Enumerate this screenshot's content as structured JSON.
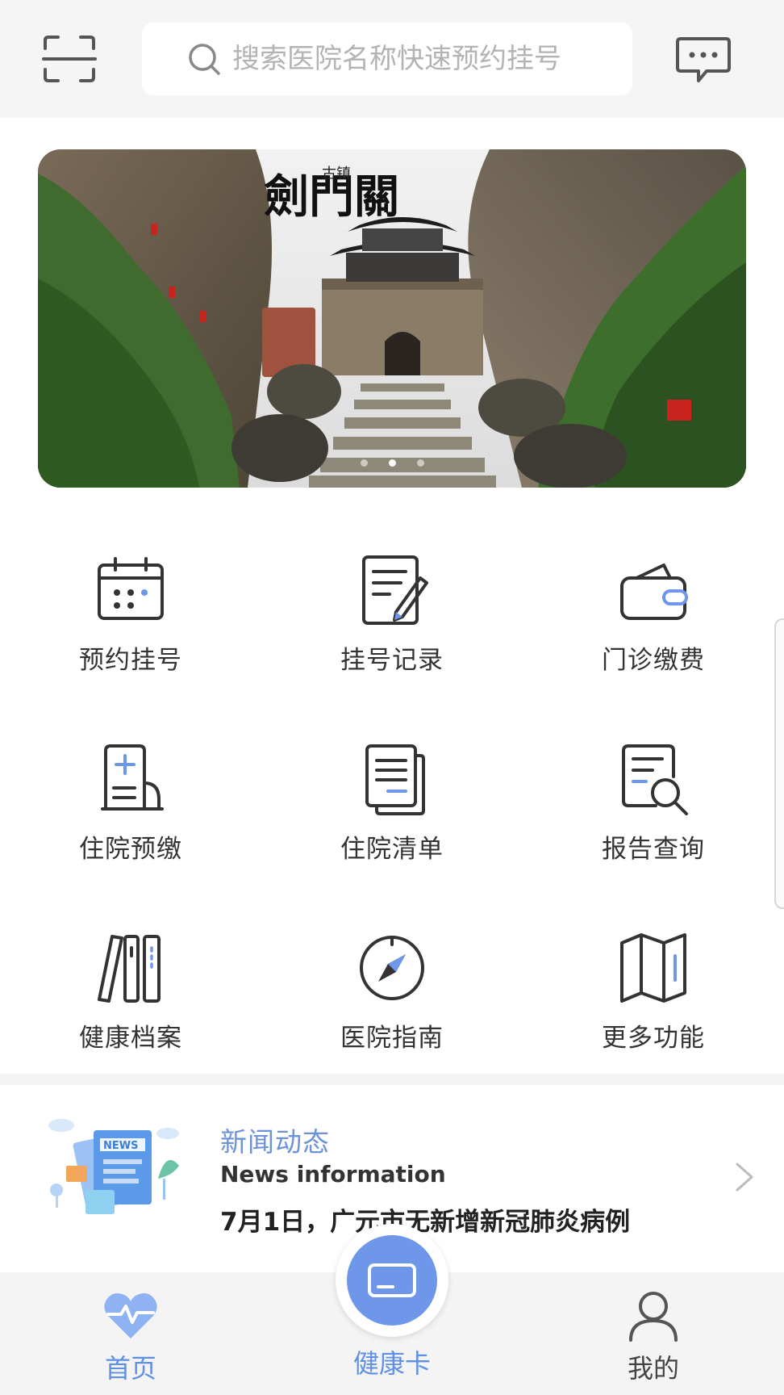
{
  "header": {
    "scan_icon": "scan-icon",
    "search_placeholder": "搜索医院名称快速预约挂号",
    "message_icon": "message-icon"
  },
  "banner": {
    "calligraphy": "劍門關",
    "small_text": "古镇",
    "dots": 3,
    "active_dot": 1
  },
  "functions": [
    {
      "label": "预约挂号",
      "icon": "calendar-icon"
    },
    {
      "label": "挂号记录",
      "icon": "record-edit-icon"
    },
    {
      "label": "门诊缴费",
      "icon": "wallet-icon"
    },
    {
      "label": "住院预缴",
      "icon": "hospital-doc-icon"
    },
    {
      "label": "住院清单",
      "icon": "list-doc-icon"
    },
    {
      "label": "报告查询",
      "icon": "report-search-icon"
    },
    {
      "label": "健康档案",
      "icon": "archive-books-icon"
    },
    {
      "label": "医院指南",
      "icon": "compass-icon"
    },
    {
      "label": "更多功能",
      "icon": "map-icon"
    }
  ],
  "news": {
    "title": "新闻动态",
    "subtitle": "News information",
    "headline": "7月1日，广元市无新增新冠肺炎病例",
    "illustration_text": "NEWS"
  },
  "bottom_nav": {
    "home": "首页",
    "health_card": "健康卡",
    "mine": "我的"
  },
  "colors": {
    "accent": "#6e97ea",
    "nav_active": "#5f8fe6",
    "news_title": "#6d92d6"
  }
}
